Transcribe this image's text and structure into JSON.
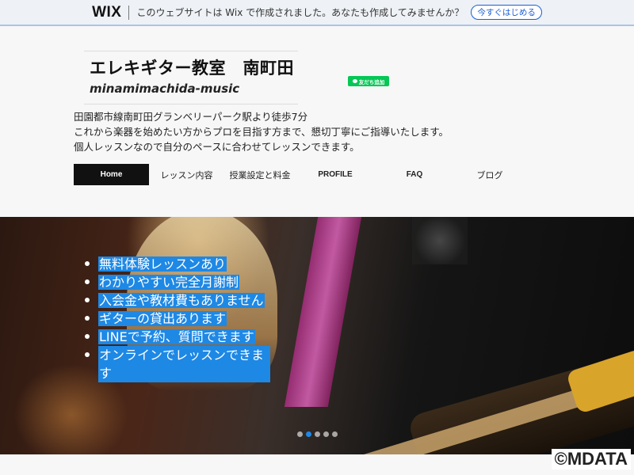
{
  "wix_banner": {
    "logo": "WIX",
    "message": "このウェブサイトは Wix で作成されました。あなたも作成してみませんか？",
    "cta": "今すぐはじめる"
  },
  "header": {
    "title": "エレキギター教室　南町田",
    "subtitle": "minamimachida-music",
    "line_button": "友だち追加",
    "description": [
      "田園都市線南町田グランベリーパーク駅より徒歩7分",
      "これから楽器を始めたい方からプロを目指す方まで、懇切丁寧にご指導いたします。",
      "個人レッスンなので自分のペースに合わせてレッスンできます。"
    ]
  },
  "nav": {
    "items": [
      "Home",
      "レッスン内容",
      "授業設定と料金",
      "PROFILE",
      "FAQ",
      "ブログ"
    ],
    "active": "Home"
  },
  "hero": {
    "bullets": [
      "無料体験レッスンあり",
      "わかりやすい完全月謝制",
      "入会金や教材費もありません",
      "ギターの貸出あります",
      "LINEで予約、質問できます",
      "オンラインでレッスンできます"
    ],
    "slide_count": 5,
    "active_slide": 2
  },
  "watermark": "©MDATA",
  "colors": {
    "highlight": "#1e88e5",
    "nav_active_bg": "#111111",
    "line_green": "#06c755",
    "wix_link": "#1b5fd6"
  }
}
